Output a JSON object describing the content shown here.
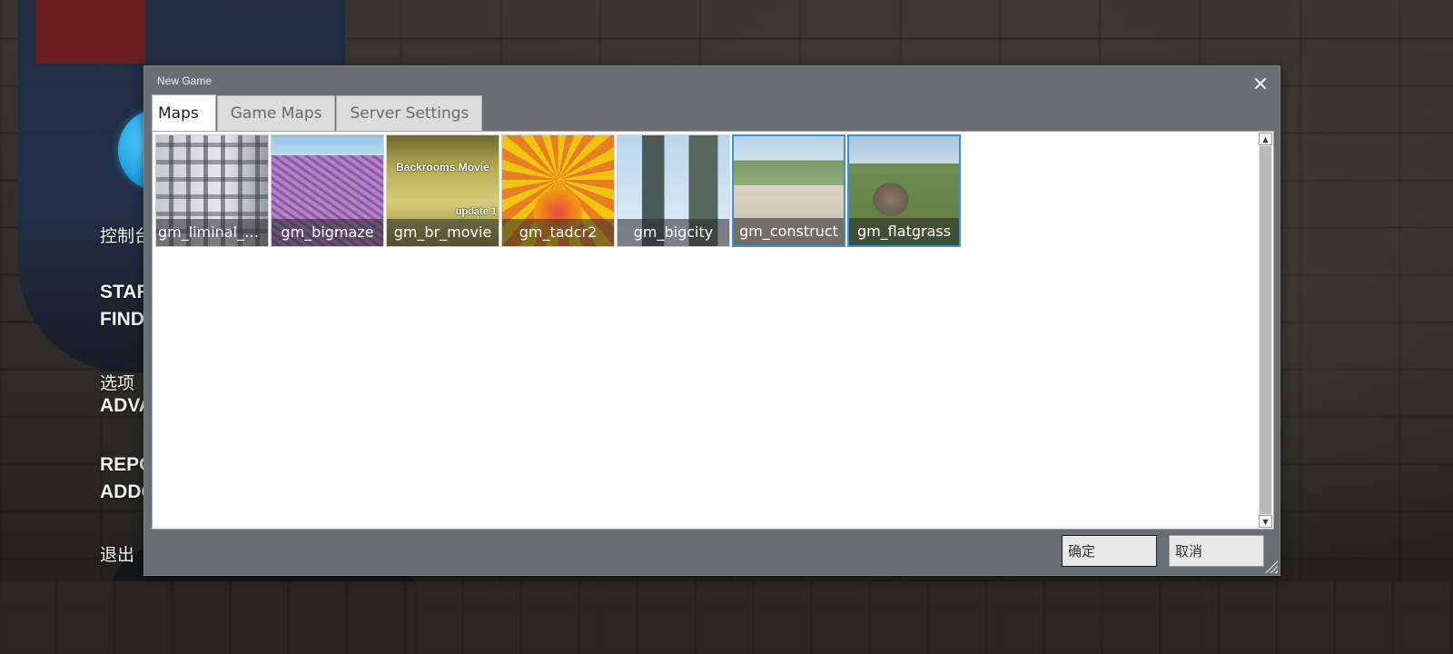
{
  "main_menu": {
    "items": [
      {
        "label": "控制台",
        "style": "cn"
      },
      {
        "label": "START NEW GAME",
        "style": "bold"
      },
      {
        "label": "FIND MULTIPLAYER GAME",
        "style": "bold"
      },
      {
        "label": "选项",
        "style": "cn"
      },
      {
        "label": "ADVANCED",
        "style": "bold"
      },
      {
        "label": "REPORT A PROBLEM",
        "style": "bold"
      },
      {
        "label": "ADDONS",
        "style": "bold"
      },
      {
        "label": "退出",
        "style": "cn"
      }
    ]
  },
  "dialog": {
    "title": "New Game",
    "close_icon": "close-icon",
    "tabs": [
      {
        "label": "Maps",
        "active": true
      },
      {
        "label": "Game Maps",
        "active": false
      },
      {
        "label": "Server Settings",
        "active": false
      }
    ],
    "maps": [
      {
        "name": "gm_liminal_h...",
        "selected": false
      },
      {
        "name": "gm_bigmaze",
        "selected": false
      },
      {
        "name": "gm_br_movie",
        "selected": false,
        "caption_top": "Backrooms Movie",
        "caption_bottom": "update 1"
      },
      {
        "name": "gm_tadcr2",
        "selected": false
      },
      {
        "name": "gm_bigcity",
        "selected": false
      },
      {
        "name": "gm_construct",
        "selected": true
      },
      {
        "name": "gm_flatgrass",
        "selected": true
      }
    ],
    "ok_label": "确定",
    "cancel_label": "取消"
  },
  "colors": {
    "dialog_bg": "#6b6e70",
    "selection": "#3a8fd8",
    "logo": "#1b9ee0"
  }
}
